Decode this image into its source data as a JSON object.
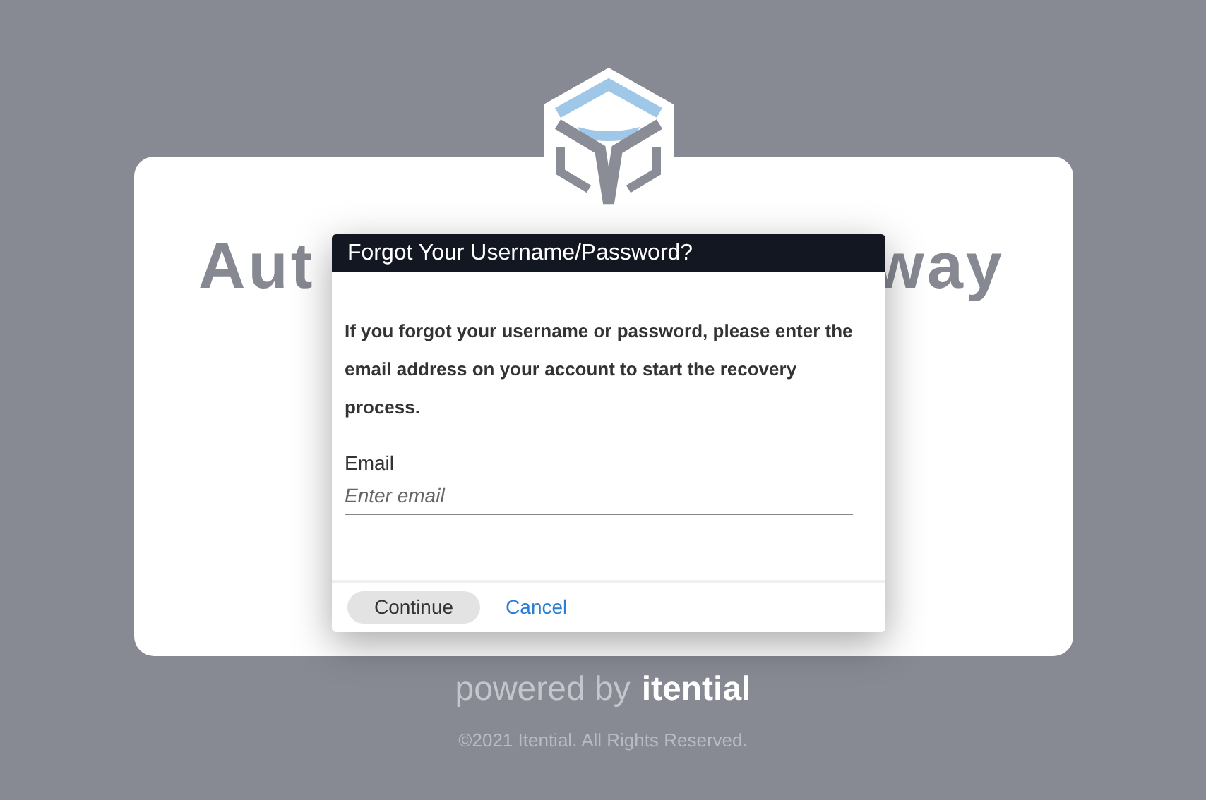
{
  "card": {
    "title_left": "Aut",
    "title_right": "way"
  },
  "dialog": {
    "title": "Forgot Your Username/Password?",
    "message": "If you forgot your username or password, please enter the email address on your account to start the recovery process.",
    "email": {
      "label": "Email",
      "placeholder": "Enter email"
    },
    "buttons": [
      {
        "label": "Continue",
        "kind": "primary"
      },
      {
        "label": "Cancel",
        "kind": "link"
      }
    ]
  },
  "footer": {
    "powered_by": "powered by",
    "brand": "itential",
    "copyright": "©2021 Itential. All Rights Reserved."
  }
}
